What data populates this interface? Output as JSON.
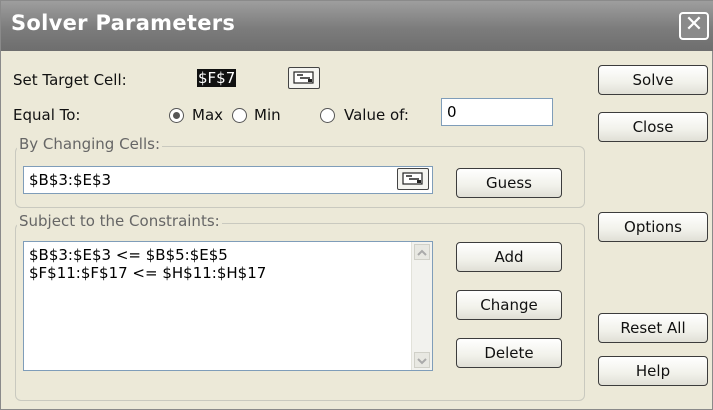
{
  "window": {
    "title": "Solver Parameters",
    "close_glyph": "✕"
  },
  "target": {
    "label": "Set Target Cell:",
    "value": "$F$7"
  },
  "equal_to": {
    "label": "Equal To:",
    "max_label": "Max",
    "min_label": "Min",
    "value_of_label": "Value of:",
    "value_of": "0",
    "selected": "Max"
  },
  "changing": {
    "label": "By Changing Cells:",
    "value": "$B$3:$E$3",
    "guess_label": "Guess"
  },
  "constraints": {
    "label": "Subject to the Constraints:",
    "items": [
      "$B$3:$E$3 <= $B$5:$E$5",
      "$F$11:$F$17 <= $H$11:$H$17"
    ],
    "add_label": "Add",
    "change_label": "Change",
    "delete_label": "Delete"
  },
  "buttons": {
    "solve": "Solve",
    "close": "Close",
    "options": "Options",
    "reset_all": "Reset All",
    "help": "Help"
  },
  "icons": {
    "collapse": "collapse-dialog-icon",
    "scroll_up": "scroll-up-arrow-icon",
    "scroll_down": "scroll-down-arrow-icon",
    "close": "close-icon"
  },
  "colors": {
    "titlebar": "#7c7c7c",
    "dialog_bg": "#ece9d8"
  }
}
